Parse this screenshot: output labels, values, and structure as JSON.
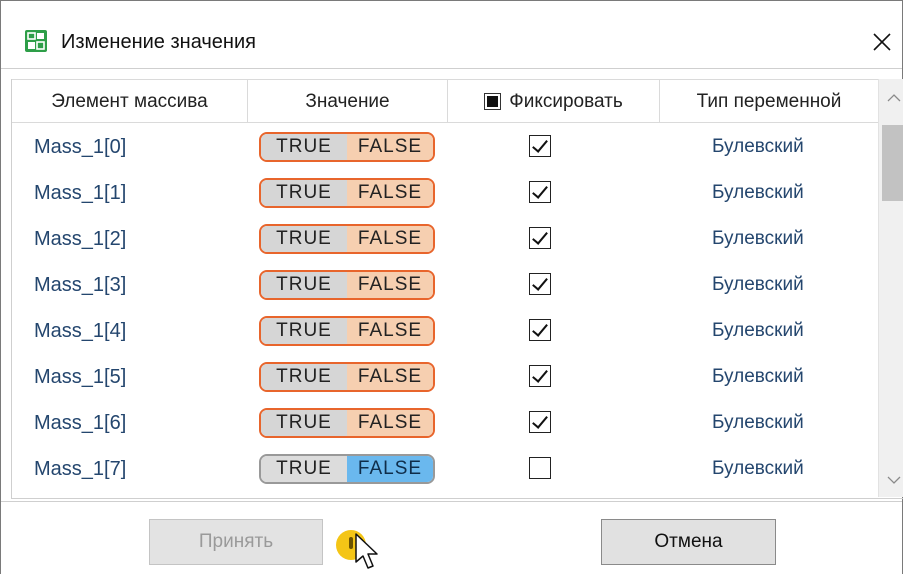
{
  "window": {
    "title": "Изменение значения",
    "close_glyph": "✕"
  },
  "columns": {
    "element": "Элемент массива",
    "value": "Значение",
    "fix": "Фиксировать",
    "type": "Тип переменной"
  },
  "rows": [
    {
      "name": "Mass_1[0]",
      "true_label": "TRUE",
      "false_label": "FALSE",
      "value": "FALSE",
      "fixed": true,
      "type": "Булевский"
    },
    {
      "name": "Mass_1[1]",
      "true_label": "TRUE",
      "false_label": "FALSE",
      "value": "FALSE",
      "fixed": true,
      "type": "Булевский"
    },
    {
      "name": "Mass_1[2]",
      "true_label": "TRUE",
      "false_label": "FALSE",
      "value": "FALSE",
      "fixed": true,
      "type": "Булевский"
    },
    {
      "name": "Mass_1[3]",
      "true_label": "TRUE",
      "false_label": "FALSE",
      "value": "FALSE",
      "fixed": true,
      "type": "Булевский"
    },
    {
      "name": "Mass_1[4]",
      "true_label": "TRUE",
      "false_label": "FALSE",
      "value": "FALSE",
      "fixed": true,
      "type": "Булевский"
    },
    {
      "name": "Mass_1[5]",
      "true_label": "TRUE",
      "false_label": "FALSE",
      "value": "FALSE",
      "fixed": true,
      "type": "Булевский"
    },
    {
      "name": "Mass_1[6]",
      "true_label": "TRUE",
      "false_label": "FALSE",
      "value": "FALSE",
      "fixed": true,
      "type": "Булевский"
    },
    {
      "name": "Mass_1[7]",
      "true_label": "TRUE",
      "false_label": "FALSE",
      "value": "FALSE",
      "fixed": false,
      "type": "Булевский"
    }
  ],
  "footer": {
    "accept_label": "Принять",
    "cancel_label": "Отмена"
  },
  "colors": {
    "accent_orange": "#e8652c",
    "selected_blue": "#6ab8ee",
    "link_text": "#24466e"
  }
}
